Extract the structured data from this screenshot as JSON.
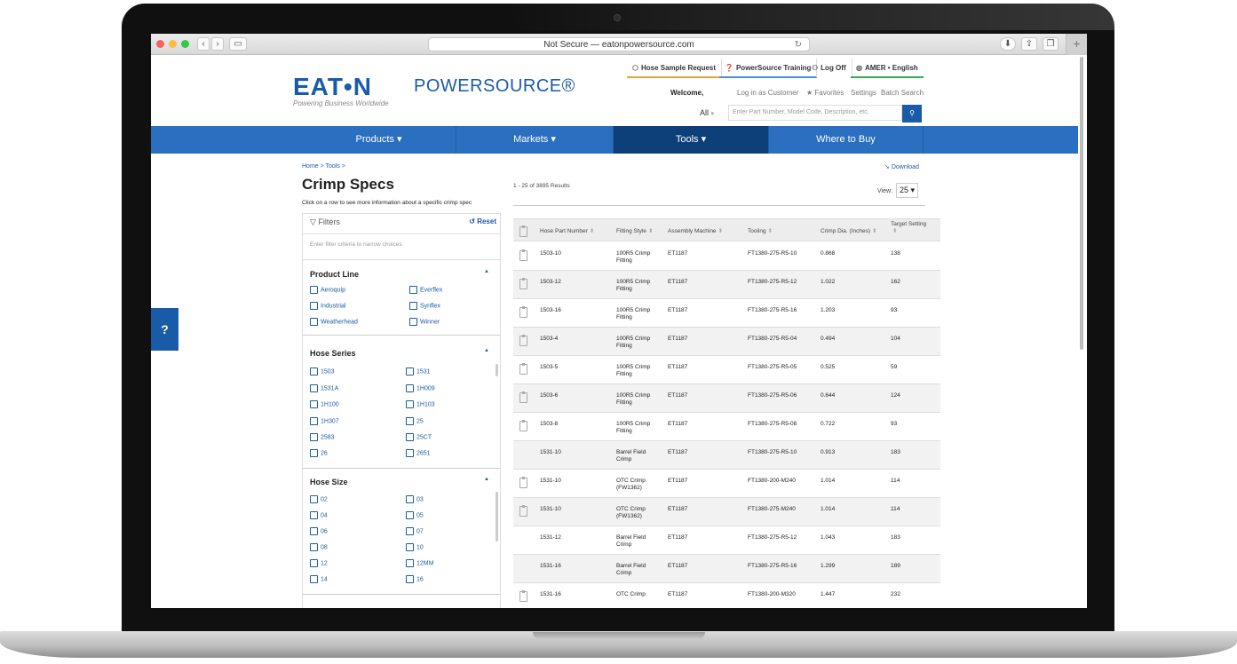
{
  "browser": {
    "url": "Not Secure — eatonpowersource.com"
  },
  "header": {
    "logo": "EAT•N",
    "tagline": "Powering Business Worldwide",
    "brand": "POWERSOURCE®",
    "utility": [
      "Hose Sample Request",
      "PowerSource Training",
      "Log Off",
      "AMER • English"
    ],
    "welcome": "Welcome,",
    "account_links": [
      "Log in as Customer",
      "★ Favorites",
      "Settings",
      "Batch Search"
    ],
    "search_scope": "All",
    "search_placeholder": "Enter Part Number, Model Code, Description, etc."
  },
  "nav": {
    "items": [
      "Products ▾",
      "Markets ▾",
      "Tools ▾",
      "Where to Buy"
    ],
    "active": "Tools ▾"
  },
  "help_label": "?",
  "page": {
    "breadcrumb": "Home  >  Tools  >",
    "title": "Crimp Specs",
    "subtitle": "Click on a row to see more information about a specific crimp spec"
  },
  "filters": {
    "heading": "Filters",
    "reset": "Reset",
    "placeholder": "Enter filter criteria to narrow choices",
    "product_line": {
      "title": "Product Line",
      "options": [
        "Aeroquip",
        "Everflex",
        "Industrial",
        "Synflex",
        "Weatherhead",
        "Winner"
      ]
    },
    "hose_series": {
      "title": "Hose Series",
      "options": [
        "1503",
        "1531",
        "1531A",
        "1H009",
        "1H100",
        "1H103",
        "1H307",
        "25",
        "2583",
        "25CT",
        "26",
        "2651"
      ]
    },
    "hose_size": {
      "title": "Hose Size",
      "options": [
        "02",
        "03",
        "04",
        "05",
        "06",
        "07",
        "08",
        "10",
        "12",
        "12MM",
        "14",
        "16"
      ]
    }
  },
  "results": {
    "count": "1 - 25 of 3895 Results",
    "download": "Download",
    "view_label": "View:",
    "view_value": "25 ▾",
    "columns": [
      "Hose Part Number",
      "Fitting Style",
      "Assembly Machine",
      "Tooling",
      "Crimp Dia. (Inches)",
      "Target Setting"
    ],
    "rows": [
      {
        "part": "1503-10",
        "style": "100R5 Crimp Fitting",
        "machine": "ET1187",
        "tooling": "FT1380-275-R5-10",
        "dia": "0.868",
        "target": "138",
        "icon": true
      },
      {
        "part": "1503-12",
        "style": "100R5 Crimp Fitting",
        "machine": "ET1187",
        "tooling": "FT1380-275-R5-12",
        "dia": "1.022",
        "target": "162",
        "icon": true
      },
      {
        "part": "1503-16",
        "style": "100R5 Crimp Fitting",
        "machine": "ET1187",
        "tooling": "FT1380-275-R5-16",
        "dia": "1.203",
        "target": "93",
        "icon": true
      },
      {
        "part": "1503-4",
        "style": "100R5 Crimp Fitting",
        "machine": "ET1187",
        "tooling": "FT1380-275-R5-04",
        "dia": "0.494",
        "target": "104",
        "icon": true
      },
      {
        "part": "1503-5",
        "style": "100R5 Crimp Fitting",
        "machine": "ET1187",
        "tooling": "FT1380-275-R5-05",
        "dia": "0.525",
        "target": "59",
        "icon": true
      },
      {
        "part": "1503-6",
        "style": "100R5 Crimp Fitting",
        "machine": "ET1187",
        "tooling": "FT1380-275-R5-06",
        "dia": "0.644",
        "target": "124",
        "icon": true
      },
      {
        "part": "1503-8",
        "style": "100R5 Crimp Fitting",
        "machine": "ET1187",
        "tooling": "FT1380-275-R5-08",
        "dia": "0.722",
        "target": "93",
        "icon": true
      },
      {
        "part": "1531-10",
        "style": "Barrel Field Crimp",
        "machine": "ET1187",
        "tooling": "FT1380-275-R5-10",
        "dia": "0.913",
        "target": "183",
        "icon": false
      },
      {
        "part": "1531-10",
        "style": "OTC Crimp (FW1362)",
        "machine": "ET1187",
        "tooling": "FT1380-200-M240",
        "dia": "1.014",
        "target": "114",
        "icon": true
      },
      {
        "part": "1531-10",
        "style": "OTC Crimp (FW1362)",
        "machine": "ET1187",
        "tooling": "FT1380-275-M240",
        "dia": "1.014",
        "target": "114",
        "icon": true
      },
      {
        "part": "1531-12",
        "style": "Barrel Field Crimp",
        "machine": "ET1187",
        "tooling": "FT1380-275-R5-12",
        "dia": "1.043",
        "target": "183",
        "icon": false
      },
      {
        "part": "1531-16",
        "style": "Barrel Field Crimp",
        "machine": "ET1187",
        "tooling": "FT1380-275-R5-16",
        "dia": "1.299",
        "target": "189",
        "icon": false
      },
      {
        "part": "1531-16",
        "style": "OTC Crimp",
        "machine": "ET1187",
        "tooling": "FT1380-200-M320",
        "dia": "1.447",
        "target": "232",
        "icon": true
      }
    ]
  }
}
